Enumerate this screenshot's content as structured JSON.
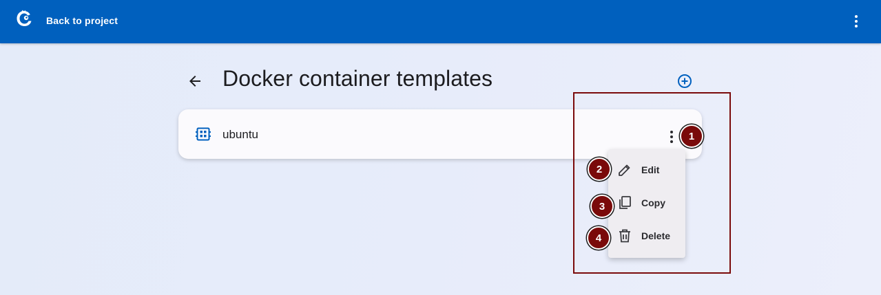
{
  "topbar": {
    "back_label": "Back to project",
    "logo_icon": "chameleon-logo-icon",
    "menu_icon": "more-vert-icon",
    "background": "#0060be"
  },
  "page": {
    "title": "Docker container templates",
    "back_icon": "arrow-back-icon",
    "add_icon": "add-circle-icon"
  },
  "templates": [
    {
      "label": "ubuntu",
      "icon": "container-icon",
      "menu_icon": "more-vert-icon"
    }
  ],
  "context_menu": {
    "items": [
      {
        "label": "Edit",
        "icon": "pencil-icon"
      },
      {
        "label": "Copy",
        "icon": "copy-icon"
      },
      {
        "label": "Delete",
        "icon": "trash-icon"
      }
    ]
  },
  "annotations": {
    "markers": [
      "1",
      "2",
      "3",
      "4"
    ],
    "color": "#7a0a0a"
  }
}
